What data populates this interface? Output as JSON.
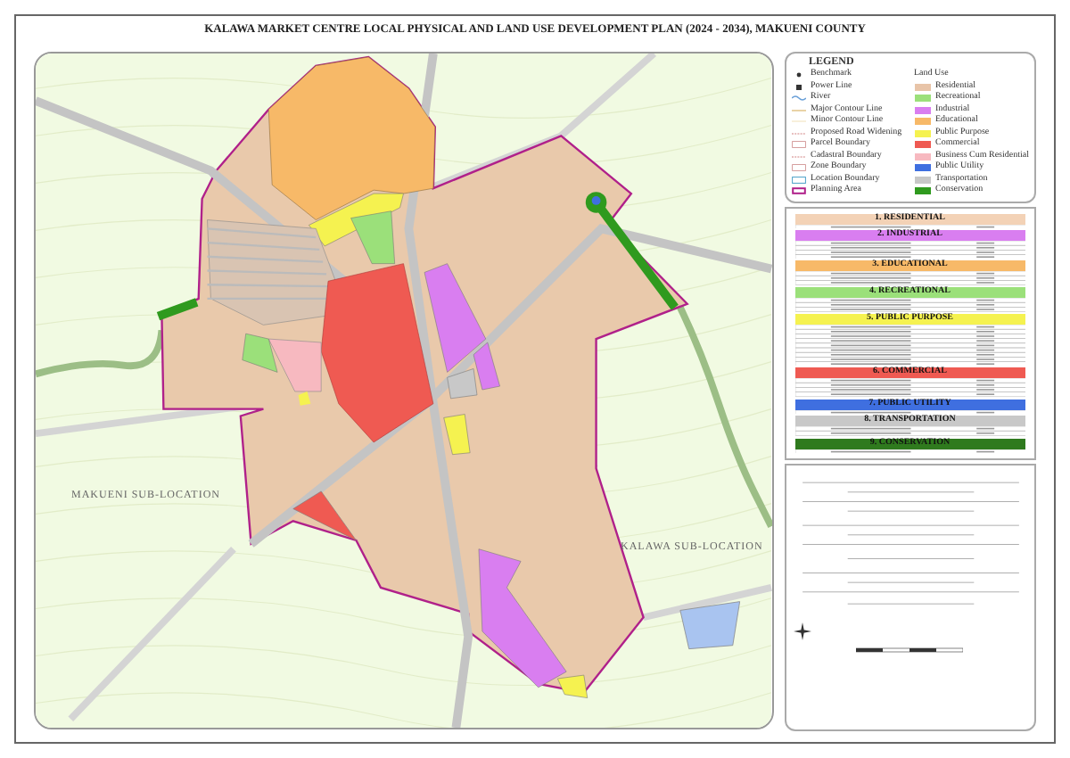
{
  "title": "KALAWA MARKET CENTRE LOCAL PHYSICAL AND LAND USE DEVELOPMENT PLAN (2024 - 2034), MAKUENI COUNTY",
  "map": {
    "area_labels": [
      "MAKUENI SUB-LOCATION",
      "KALAWA SUB-LOCATION"
    ]
  },
  "legend": {
    "title": "LEGEND",
    "land_use_title": "Land Use",
    "symbols": [
      {
        "kind": "point",
        "label": "Benchmark"
      },
      {
        "kind": "square-point",
        "label": "Power Line"
      },
      {
        "kind": "river",
        "label": "River"
      },
      {
        "kind": "major-contour",
        "label": "Major Contour Line"
      },
      {
        "kind": "minor-contour",
        "label": "Minor Contour Line"
      },
      {
        "kind": "dashed-line",
        "label": "Proposed Road Widening"
      },
      {
        "kind": "box",
        "label": "Parcel Boundary"
      },
      {
        "kind": "dashed-line",
        "label": "Cadastral Boundary"
      },
      {
        "kind": "box",
        "label": "Zone Boundary"
      },
      {
        "kind": "blue-box",
        "label": "Location Boundary"
      },
      {
        "kind": "thick-box",
        "label": "Planning Area"
      }
    ],
    "land_uses": [
      {
        "label": "Residential",
        "color": "#e8c4a8"
      },
      {
        "label": "Recreational",
        "color": "#9be07a"
      },
      {
        "label": "Industrial",
        "color": "#d97ef0"
      },
      {
        "label": "Educational",
        "color": "#f7b968"
      },
      {
        "label": "Public Purpose",
        "color": "#f5f250"
      },
      {
        "label": "Commercial",
        "color": "#ef5a52"
      },
      {
        "label": "Business Cum Residential",
        "color": "#f7b9c0"
      },
      {
        "label": "Public Utility",
        "color": "#3f6fe0"
      },
      {
        "label": "Transportation",
        "color": "#c8c8c8"
      },
      {
        "label": "Conservation",
        "color": "#2f9a1e"
      }
    ]
  },
  "land_use_table": {
    "sections": [
      {
        "label": "1. RESIDENTIAL",
        "color": "#f3d2b6"
      },
      {
        "label": "2. INDUSTRIAL",
        "color": "#d97ef0"
      },
      {
        "label": "3. EDUCATIONAL",
        "color": "#f7b968"
      },
      {
        "label": "4. RECREATIONAL",
        "color": "#9be07a"
      },
      {
        "label": "5. PUBLIC PURPOSE",
        "color": "#f5f250"
      },
      {
        "label": "6. COMMERCIAL",
        "color": "#ef5a52"
      },
      {
        "label": "7. PUBLIC UTILITY",
        "color": "#3f6fe0"
      },
      {
        "label": "8. TRANSPORTATION",
        "color": "#c8c8c8"
      },
      {
        "label": "9. CONSERVATION",
        "color": "#2f7a1e"
      }
    ]
  }
}
